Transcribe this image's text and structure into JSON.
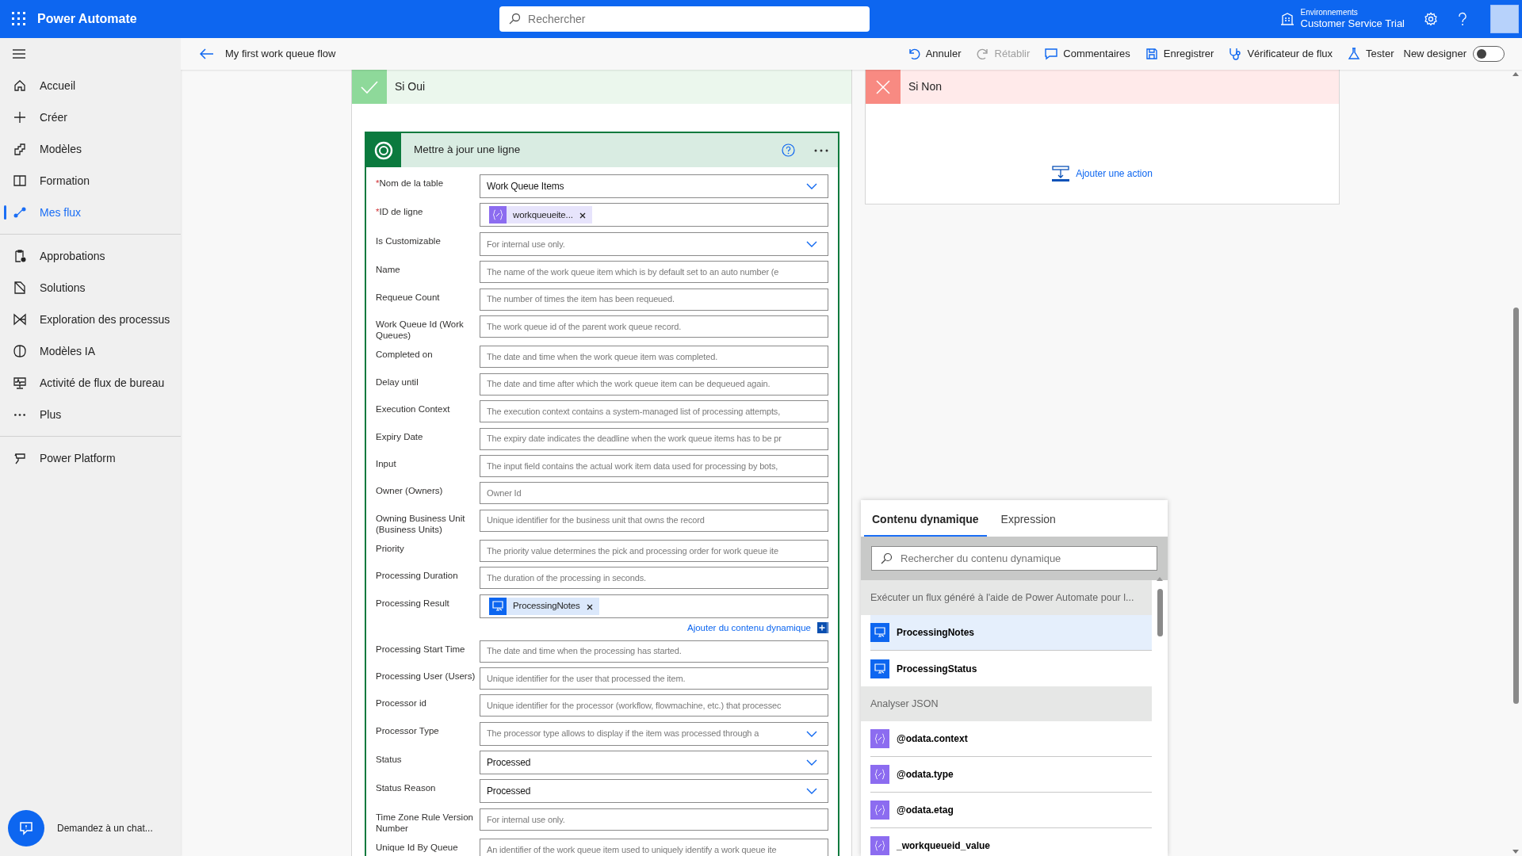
{
  "header": {
    "app_title": "Power Automate",
    "search": {
      "placeholder": "Rechercher"
    },
    "environment_label": "Environnements",
    "environment_name": "Customer Service Trial"
  },
  "command_bar": {
    "flow_name": "My first work queue flow",
    "actions": [
      {
        "label": "Annuler",
        "disabled": false
      },
      {
        "label": "Rétablir",
        "disabled": true
      },
      {
        "label": "Commentaires",
        "disabled": false
      },
      {
        "label": "Enregistrer",
        "disabled": false
      },
      {
        "label": "Vérificateur de flux",
        "disabled": false
      },
      {
        "label": "Tester",
        "disabled": false
      }
    ],
    "toggle": {
      "label": "New designer",
      "on": false
    }
  },
  "sidebar": {
    "sections": [
      [
        {
          "label": "Accueil",
          "selected": false
        },
        {
          "label": "Créer",
          "selected": false
        },
        {
          "label": "Modèles",
          "selected": false
        },
        {
          "label": "Formation",
          "selected": false
        },
        {
          "label": "Mes flux",
          "selected": true
        }
      ],
      [
        {
          "label": "Approbations",
          "selected": false
        },
        {
          "label": "Solutions",
          "selected": false
        },
        {
          "label": "Exploration des processus",
          "selected": false
        },
        {
          "label": "Modèles IA",
          "selected": false
        },
        {
          "label": "Activité de flux de bureau",
          "selected": false
        },
        {
          "label": "Plus",
          "selected": false
        }
      ],
      [
        {
          "label": "Power Platform",
          "selected": false
        }
      ]
    ],
    "chat_prompt": "Demandez à un chat..."
  },
  "branches": [
    {
      "kind": "yes",
      "title": "Si Oui"
    },
    {
      "kind": "no",
      "title": "Si Non",
      "add_action": "Ajouter une action"
    }
  ],
  "action_card": {
    "title": "Mettre à jour une ligne",
    "required_mark": "*",
    "fields": [
      {
        "label": "Nom de la table",
        "required": true,
        "kind": "dropdown",
        "value": "Work Queue Items"
      },
      {
        "label": "ID de ligne",
        "required": true,
        "kind": "token",
        "token": {
          "label": "workqueueite...",
          "kind": "expression"
        }
      },
      {
        "label": "Is Customizable",
        "required": false,
        "kind": "dropdown",
        "placeholder": "For internal use only."
      },
      {
        "label": "Name",
        "required": false,
        "kind": "text",
        "placeholder": "The name of the work queue item which is by default set to an auto number (e"
      },
      {
        "label": "Requeue Count",
        "required": false,
        "kind": "text",
        "placeholder": "The number of times the item has been requeued."
      },
      {
        "label": "Work Queue Id (Work Queues)",
        "required": false,
        "kind": "text",
        "placeholder": "The work queue id of the parent work queue record."
      },
      {
        "label": "Completed on",
        "required": false,
        "kind": "text",
        "placeholder": "The date and time when the work queue item was completed."
      },
      {
        "label": "Delay until",
        "required": false,
        "kind": "text",
        "placeholder": "The date and time after which the work queue item can be dequeued again."
      },
      {
        "label": "Execution Context",
        "required": false,
        "kind": "text",
        "placeholder": "The execution context contains a system-managed list of processing attempts,"
      },
      {
        "label": "Expiry Date",
        "required": false,
        "kind": "text",
        "placeholder": "The expiry date indicates the deadline when the work queue items has to be pr"
      },
      {
        "label": "Input",
        "required": false,
        "kind": "text",
        "placeholder": "The input field contains the actual work item data used for processing by bots,"
      },
      {
        "label": "Owner (Owners)",
        "required": false,
        "kind": "text",
        "placeholder": "Owner Id"
      },
      {
        "label": "Owning Business Unit (Business Units)",
        "required": false,
        "kind": "text",
        "placeholder": "Unique identifier for the business unit that owns the record"
      },
      {
        "label": "Priority",
        "required": false,
        "kind": "text",
        "placeholder": "The priority value determines the pick and processing order for work queue ite"
      },
      {
        "label": "Processing Duration",
        "required": false,
        "kind": "text",
        "placeholder": "The duration of the processing in seconds."
      },
      {
        "label": "Processing Result",
        "required": false,
        "kind": "token",
        "token": {
          "label": "ProcessingNotes",
          "kind": "output"
        },
        "add_dynamic": "Ajouter du contenu dynamique"
      },
      {
        "label": "Processing Start Time",
        "required": false,
        "kind": "text",
        "placeholder": "The date and time when the processing has started."
      },
      {
        "label": "Processing User (Users)",
        "required": false,
        "kind": "text",
        "placeholder": "Unique identifier for the user that processed the item."
      },
      {
        "label": "Processor id",
        "required": false,
        "kind": "text",
        "placeholder": "Unique identifier for the processor (workflow, flowmachine, etc.) that processec"
      },
      {
        "label": "Processor Type",
        "required": false,
        "kind": "dropdown",
        "placeholder": "The processor type allows to display if the item was processed through a"
      },
      {
        "label": "Status",
        "required": false,
        "kind": "dropdown",
        "value": "Processed"
      },
      {
        "label": "Status Reason",
        "required": false,
        "kind": "dropdown",
        "value": "Processed"
      },
      {
        "label": "Time Zone Rule Version Number",
        "required": false,
        "kind": "text",
        "placeholder": "For internal use only."
      },
      {
        "label": "Unique Id By Queue",
        "required": false,
        "kind": "text",
        "placeholder": "An identifier of the work queue item used to uniquely identify a work queue ite"
      }
    ]
  },
  "dynamic_panel": {
    "tabs": [
      {
        "label": "Contenu dynamique",
        "selected": true
      },
      {
        "label": "Expression",
        "selected": false
      }
    ],
    "search": {
      "placeholder": "Rechercher du contenu dynamique"
    },
    "groups": [
      {
        "title": "Exécuter un flux généré à l'aide de Power Automate pour l...",
        "items": [
          {
            "label": "ProcessingNotes",
            "kind": "output",
            "selected": true
          },
          {
            "label": "ProcessingStatus",
            "kind": "output",
            "selected": false
          }
        ]
      },
      {
        "title": "Analyser JSON",
        "items": [
          {
            "label": "@odata.context",
            "kind": "expression",
            "selected": false
          },
          {
            "label": "@odata.type",
            "kind": "expression",
            "selected": false
          },
          {
            "label": "@odata.etag",
            "kind": "expression",
            "selected": false
          },
          {
            "label": "_workqueueid_value",
            "kind": "expression",
            "selected": false
          }
        ]
      }
    ]
  }
}
